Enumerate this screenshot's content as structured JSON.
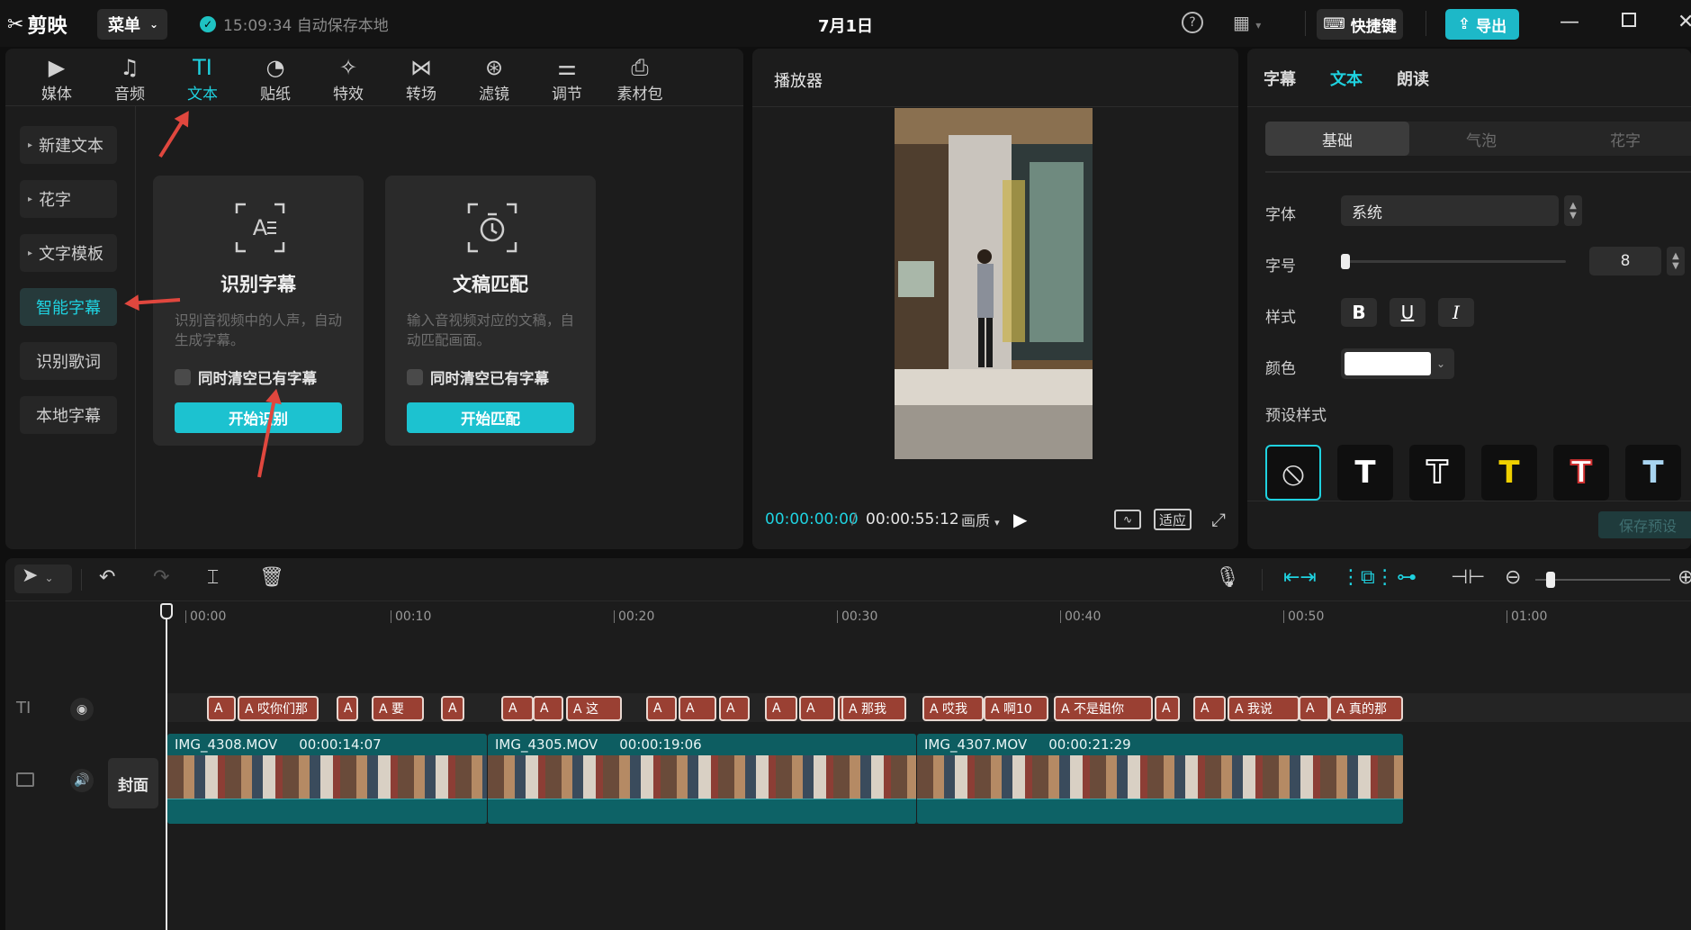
{
  "titlebar": {
    "app_name": "剪映",
    "menu_label": "菜单",
    "autosave_text": "15:09:34 自动保存本地",
    "doc_title": "7月1日",
    "shortcut_label": "快捷键",
    "export_label": "导出"
  },
  "tools": [
    {
      "label": "媒体",
      "icon": "media-icon"
    },
    {
      "label": "音频",
      "icon": "audio-icon"
    },
    {
      "label": "文本",
      "icon": "text-icon",
      "active": true
    },
    {
      "label": "贴纸",
      "icon": "sticker-icon"
    },
    {
      "label": "特效",
      "icon": "effects-icon"
    },
    {
      "label": "转场",
      "icon": "transition-icon"
    },
    {
      "label": "滤镜",
      "icon": "filter-icon"
    },
    {
      "label": "调节",
      "icon": "adjust-icon"
    },
    {
      "label": "素材包",
      "icon": "package-icon"
    }
  ],
  "text_nav": [
    {
      "label": "新建文本"
    },
    {
      "label": "花字"
    },
    {
      "label": "文字模板"
    },
    {
      "label": "智能字幕",
      "active": true
    },
    {
      "label": "识别歌词"
    },
    {
      "label": "本地字幕"
    }
  ],
  "cards": [
    {
      "title": "识别字幕",
      "desc": "识别音视频中的人声，自动生成字幕。",
      "check_label": "同时清空已有字幕",
      "button": "开始识别"
    },
    {
      "title": "文稿匹配",
      "desc": "输入音视频对应的文稿，自动匹配画面。",
      "check_label": "同时清空已有字幕",
      "button": "开始匹配"
    }
  ],
  "player": {
    "title": "播放器",
    "current_time": "00:00:00:00",
    "total_time": "00:00:55:12",
    "quality_label": "画质",
    "fit_label": "适应"
  },
  "props": {
    "tabs": [
      "字幕",
      "文本",
      "朗读"
    ],
    "active_tab": "文本",
    "segments": [
      "基础",
      "气泡",
      "花字"
    ],
    "font_label": "字体",
    "font_value": "系统",
    "size_label": "字号",
    "size_value": "8",
    "style_label": "样式",
    "color_label": "颜色",
    "color_value": "#ffffff",
    "preset_label": "预设样式",
    "save_preset": "保存预设"
  },
  "timeline": {
    "ruler_ticks": [
      "00:00",
      "00:10",
      "00:20",
      "00:30",
      "00:40",
      "00:50",
      "01:00"
    ],
    "cover_label": "封面",
    "text_clips": [
      {
        "label": "A"
      },
      {
        "label": "A 哎你们那"
      },
      {
        "label": "A"
      },
      {
        "label": "A 要"
      },
      {
        "label": "A"
      },
      {
        "label": "A"
      },
      {
        "label": "A"
      },
      {
        "label": "A 这"
      },
      {
        "label": "A"
      },
      {
        "label": "A"
      },
      {
        "label": "A"
      },
      {
        "label": "A"
      },
      {
        "label": "A"
      },
      {
        "label": "A"
      },
      {
        "label": "A 那我"
      },
      {
        "label": "A 哎我"
      },
      {
        "label": "A 啊10"
      },
      {
        "label": "A 不是姐你"
      },
      {
        "label": "A"
      },
      {
        "label": "A"
      },
      {
        "label": "A 我说"
      },
      {
        "label": "A"
      },
      {
        "label": "A 真的那"
      }
    ],
    "video_clips": [
      {
        "name": "IMG_4308.MOV",
        "duration": "00:00:14:07"
      },
      {
        "name": "IMG_4305.MOV",
        "duration": "00:00:19:06"
      },
      {
        "name": "IMG_4307.MOV",
        "duration": "00:00:21:29"
      }
    ]
  },
  "colors": {
    "accent": "#1fd2e0",
    "text_clip": "#9a4033",
    "video_clip": "#0d5d61",
    "annotation_arrow": "#e0473e"
  }
}
